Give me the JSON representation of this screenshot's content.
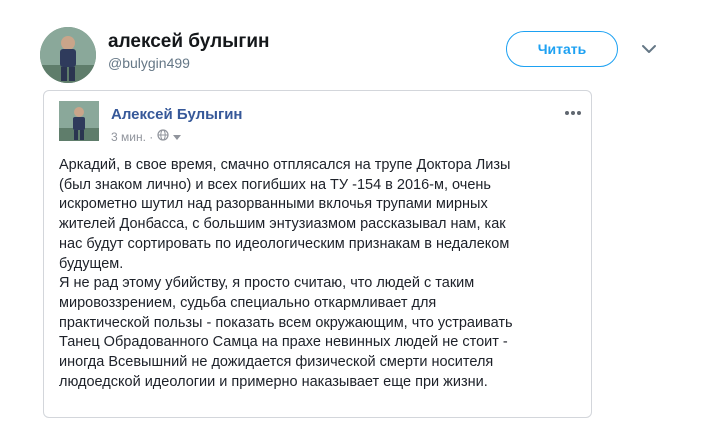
{
  "tweet": {
    "author_name": "алексей булыгин",
    "author_handle": "@bulygin499",
    "follow_label": "Читать",
    "caret_icon": "chevron-down-icon"
  },
  "fb_post": {
    "author_name": "Алексей Булыгин",
    "time": "3 мин. ·",
    "privacy_icon": "globe-icon",
    "more_icon": "more-dots-icon",
    "paragraph_1": "Аркадий, в свое время, смачно отплясался на трупе Доктора Лизы\n(был знаком лично) и всех погибших на ТУ -154 в 2016-м, очень\nискрометно шутил над разорванными вклочья трупами мирных\nжителей Донбасса, с большим энтузиазмом рассказывал нам, как\nнас будут сортировать по идеологическим признакам в недалеком\nбудущем.",
    "paragraph_2": "Я не рад этому убийству, я просто считаю, что людей с таким\nмировоззрением, судьба специально откармливает для\nпрактической пользы - показать всем окружающим, что устраивать\nТанец Обрадованного Самца на прахе невинных людей не стоит -\nиногда Всевышний не дожидается физической смерти носителя\nлюдоедской идеологии и примерно наказывает еще при жизни."
  },
  "colors": {
    "follow_blue": "#1da1f2",
    "fb_name_blue": "#365899",
    "meta_gray": "#90949c",
    "border": "#d3d6db"
  }
}
